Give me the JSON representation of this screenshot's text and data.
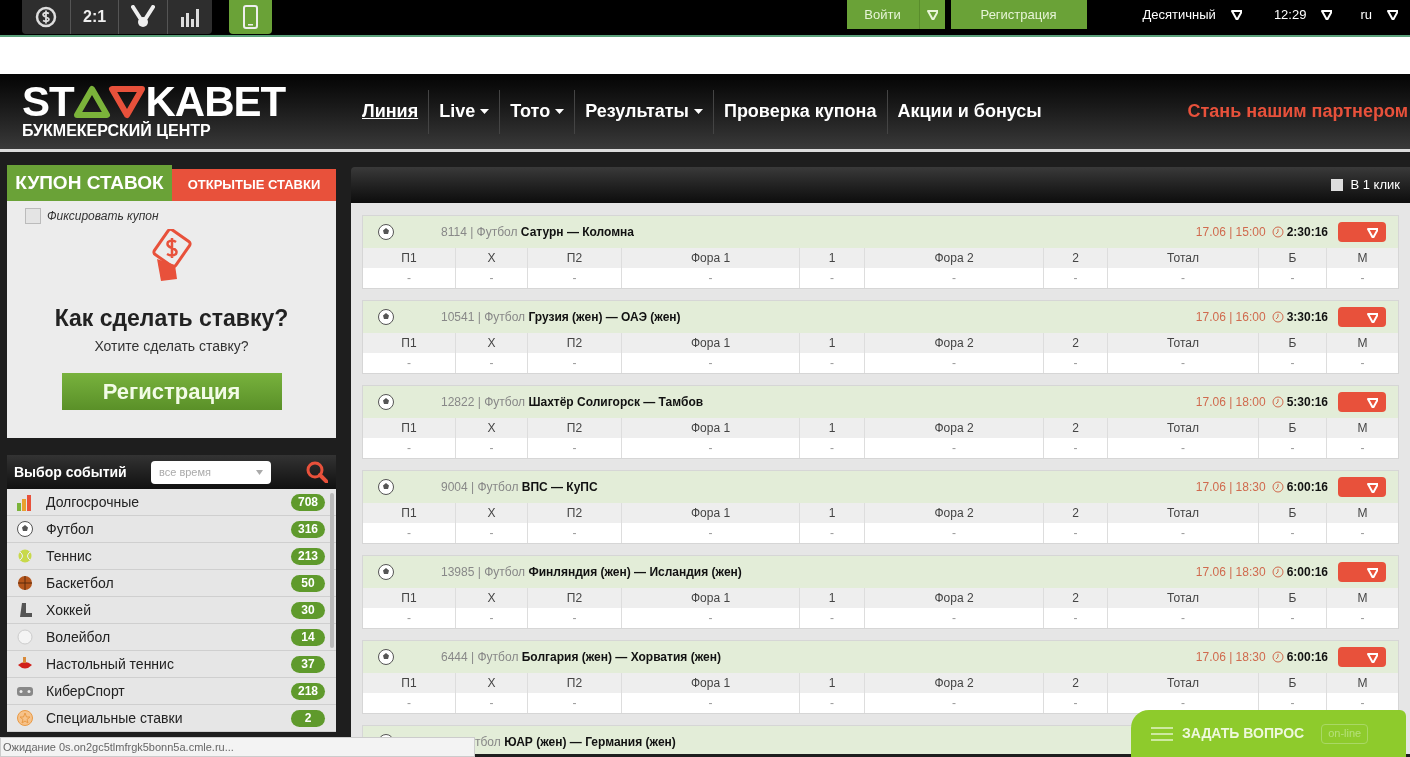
{
  "top_bar": {
    "odds_label": "2:1",
    "login": "Войти",
    "register": "Регистрация",
    "format": "Десятичный",
    "time": "12:29",
    "language": "ru"
  },
  "header": {
    "logo": {
      "left": "ST",
      "right": "KABET",
      "subtitle": "БУКМЕКЕРСКИЙ ЦЕНТР"
    },
    "nav": [
      {
        "label": "Линия",
        "selected": true,
        "dropdown": false
      },
      {
        "label": "Live",
        "selected": false,
        "dropdown": true
      },
      {
        "label": "Тото",
        "selected": false,
        "dropdown": true
      },
      {
        "label": "Результаты",
        "selected": false,
        "dropdown": true
      },
      {
        "label": "Проверка купона",
        "selected": false,
        "dropdown": false
      },
      {
        "label": "Акции и бонусы",
        "selected": false,
        "dropdown": false
      }
    ],
    "partner_link": "Стань нашим партнером"
  },
  "coupon": {
    "tabs": [
      {
        "label": "КУПОН СТАВОК",
        "selected": true
      },
      {
        "label": "ОТКРЫТЫЕ СТАВКИ",
        "selected": false
      }
    ],
    "fix_coupon": {
      "label": "Фиксировать купон",
      "checked": false
    },
    "heading": "Как сделать ставку?",
    "subtext": "Хотите сделать ставку?",
    "button": "Регистрация"
  },
  "event_filter": {
    "title": "Выбор событий",
    "period": "все время"
  },
  "sports": [
    {
      "kind": "chart",
      "name": "Долгосрочные",
      "count": "708"
    },
    {
      "kind": "football",
      "name": "Футбол",
      "count": "316"
    },
    {
      "kind": "tennis",
      "name": "Теннис",
      "count": "213"
    },
    {
      "kind": "basketball",
      "name": "Баскетбол",
      "count": "50"
    },
    {
      "kind": "hockey",
      "name": "Хоккей",
      "count": "30"
    },
    {
      "kind": "volleyball",
      "name": "Волейбол",
      "count": "14"
    },
    {
      "kind": "pingpong",
      "name": "Настольный теннис",
      "count": "37"
    },
    {
      "kind": "gamepad",
      "name": "КиберСпорт",
      "count": "218"
    },
    {
      "kind": "star",
      "name": "Специальные ставки",
      "count": "2"
    }
  ],
  "one_click": {
    "label": "В 1 клик",
    "checked": false
  },
  "events": [
    {
      "label": "8114 | Футбол",
      "teams": "Сатурн — Коломна",
      "date": "17.06 | 15:00",
      "countdown": "2:30:16",
      "columns": [
        "П1",
        "X",
        "П2",
        "Фора 1",
        "1",
        "Фора 2",
        "2",
        "Тотал",
        "Б",
        "М"
      ],
      "odds": [
        "-",
        "-",
        "-",
        "-",
        "-",
        "-",
        "-",
        "-",
        "-",
        "-"
      ]
    },
    {
      "label": "10541 | Футбол",
      "teams": "Грузия (жен) — ОАЭ (жен)",
      "date": "17.06 | 16:00",
      "countdown": "3:30:16",
      "columns": [
        "П1",
        "X",
        "П2",
        "Фора 1",
        "1",
        "Фора 2",
        "2",
        "Тотал",
        "Б",
        "М"
      ],
      "odds": [
        "-",
        "-",
        "-",
        "-",
        "-",
        "-",
        "-",
        "-",
        "-",
        "-"
      ]
    },
    {
      "label": "12822 | Футбол",
      "teams": "Шахтёр Солигорск — Тамбов",
      "date": "17.06 | 18:00",
      "countdown": "5:30:16",
      "columns": [
        "П1",
        "X",
        "П2",
        "Фора 1",
        "1",
        "Фора 2",
        "2",
        "Тотал",
        "Б",
        "М"
      ],
      "odds": [
        "-",
        "-",
        "-",
        "-",
        "-",
        "-",
        "-",
        "-",
        "-",
        "-"
      ]
    },
    {
      "label": "9004 | Футбол",
      "teams": "ВПС — КуПС",
      "date": "17.06 | 18:30",
      "countdown": "6:00:16",
      "columns": [
        "П1",
        "X",
        "П2",
        "Фора 1",
        "1",
        "Фора 2",
        "2",
        "Тотал",
        "Б",
        "М"
      ],
      "odds": [
        "-",
        "-",
        "-",
        "-",
        "-",
        "-",
        "-",
        "-",
        "-",
        "-"
      ]
    },
    {
      "label": "13985 | Футбол",
      "teams": "Финляндия (жен) — Исландия (жен)",
      "date": "17.06 | 18:30",
      "countdown": "6:00:16",
      "columns": [
        "П1",
        "X",
        "П2",
        "Фора 1",
        "1",
        "Фора 2",
        "2",
        "Тотал",
        "Б",
        "М"
      ],
      "odds": [
        "-",
        "-",
        "-",
        "-",
        "-",
        "-",
        "-",
        "-",
        "-",
        "-"
      ]
    },
    {
      "label": "6444 | Футбол",
      "teams": "Болгария (жен) — Хорватия (жен)",
      "date": "17.06 | 18:30",
      "countdown": "6:00:16",
      "columns": [
        "П1",
        "X",
        "П2",
        "Фора 1",
        "1",
        "Фора 2",
        "2",
        "Тотал",
        "Б",
        "М"
      ],
      "odds": [
        "-",
        "-",
        "-",
        "-",
        "-",
        "-",
        "-",
        "-",
        "-",
        "-"
      ]
    },
    {
      "label": "тбол",
      "teams": "ЮАР (жен) — Германия (жен)"
    }
  ],
  "chat_widget": {
    "label": "ЗАДАТЬ ВОПРОС",
    "status": "on-line"
  },
  "status_bar": "Ожидание 0s.on2gc5tlmfrgk5bonn5a.cmle.ru..."
}
